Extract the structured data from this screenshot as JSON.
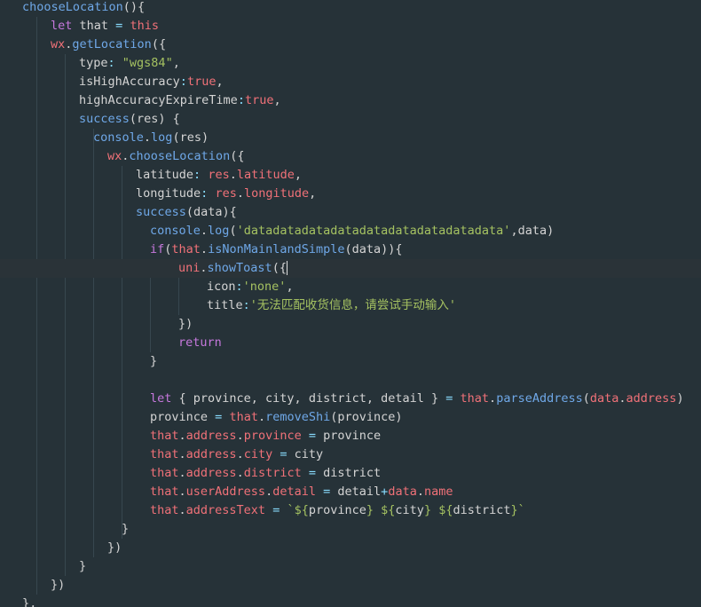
{
  "editor": {
    "colors": {
      "background": "#263238",
      "current_line": "#2a3338",
      "plain": "#d4d4d4",
      "function": "#6fa8e8",
      "keyword": "#c678dd",
      "variable": "#f07178",
      "string": "#a5c261",
      "operator": "#89ddff"
    },
    "lines": [
      [
        [
          "fn",
          "chooseLocation"
        ],
        [
          "punc",
          "(){"
        ]
      ],
      [
        [
          "kw",
          "let"
        ],
        [
          "plain",
          " that "
        ],
        [
          "op",
          "="
        ],
        [
          "plain",
          " "
        ],
        [
          "var",
          "this"
        ]
      ],
      [
        [
          "var",
          "wx"
        ],
        [
          "punc",
          "."
        ],
        [
          "fn",
          "getLocation"
        ],
        [
          "punc",
          "({"
        ]
      ],
      [
        [
          "plain",
          "type"
        ],
        [
          "op",
          ":"
        ],
        [
          "plain",
          " "
        ],
        [
          "str",
          "\"wgs84\""
        ],
        [
          "punc",
          ","
        ]
      ],
      [
        [
          "plain",
          "isHighAccuracy"
        ],
        [
          "op",
          ":"
        ],
        [
          "var",
          "true"
        ],
        [
          "punc",
          ","
        ]
      ],
      [
        [
          "plain",
          "highAccuracyExpireTime"
        ],
        [
          "op",
          ":"
        ],
        [
          "var",
          "true"
        ],
        [
          "punc",
          ","
        ]
      ],
      [
        [
          "fn",
          "success"
        ],
        [
          "punc",
          "(res) {"
        ]
      ],
      [
        [
          "fn",
          "console"
        ],
        [
          "punc",
          "."
        ],
        [
          "fn",
          "log"
        ],
        [
          "punc",
          "(res)"
        ]
      ],
      [
        [
          "var",
          "wx"
        ],
        [
          "punc",
          "."
        ],
        [
          "fn",
          "chooseLocation"
        ],
        [
          "punc",
          "({"
        ]
      ],
      [
        [
          "plain",
          "latitude"
        ],
        [
          "op",
          ":"
        ],
        [
          "plain",
          " "
        ],
        [
          "var",
          "res"
        ],
        [
          "punc",
          "."
        ],
        [
          "var",
          "latitude"
        ],
        [
          "punc",
          ","
        ]
      ],
      [
        [
          "plain",
          "longitude"
        ],
        [
          "op",
          ":"
        ],
        [
          "plain",
          " "
        ],
        [
          "var",
          "res"
        ],
        [
          "punc",
          "."
        ],
        [
          "var",
          "longitude"
        ],
        [
          "punc",
          ","
        ]
      ],
      [
        [
          "fn",
          "success"
        ],
        [
          "punc",
          "(data){"
        ]
      ],
      [
        [
          "fn",
          "console"
        ],
        [
          "punc",
          "."
        ],
        [
          "fn",
          "log"
        ],
        [
          "punc",
          "("
        ],
        [
          "str",
          "'datadatadatadatadatadatadatadatadata'"
        ],
        [
          "punc",
          ",data)"
        ]
      ],
      [
        [
          "kw",
          "if"
        ],
        [
          "punc",
          "("
        ],
        [
          "var",
          "that"
        ],
        [
          "punc",
          "."
        ],
        [
          "fn",
          "isNonMainlandSimple"
        ],
        [
          "punc",
          "(data)){"
        ]
      ],
      [
        [
          "var",
          "uni"
        ],
        [
          "punc",
          "."
        ],
        [
          "fn",
          "showToast"
        ],
        [
          "punc",
          "({"
        ],
        [
          "caret",
          ""
        ]
      ],
      [
        [
          "plain",
          "icon"
        ],
        [
          "op",
          ":"
        ],
        [
          "str",
          "'none'"
        ],
        [
          "punc",
          ","
        ]
      ],
      [
        [
          "plain",
          "title"
        ],
        [
          "op",
          ":"
        ],
        [
          "str",
          "'无法匹配收货信息，请尝试手动输入'"
        ]
      ],
      [
        [
          "punc",
          "})"
        ]
      ],
      [
        [
          "kw",
          "return"
        ]
      ],
      [
        [
          "punc",
          "}"
        ]
      ],
      [],
      [
        [
          "kw",
          "let"
        ],
        [
          "punc",
          " { province, city, district, detail } "
        ],
        [
          "op",
          "="
        ],
        [
          "plain",
          " "
        ],
        [
          "var",
          "that"
        ],
        [
          "punc",
          "."
        ],
        [
          "fn",
          "parseAddress"
        ],
        [
          "punc",
          "("
        ],
        [
          "var",
          "data"
        ],
        [
          "punc",
          "."
        ],
        [
          "var",
          "address"
        ],
        [
          "punc",
          ")"
        ]
      ],
      [
        [
          "plain",
          "province "
        ],
        [
          "op",
          "="
        ],
        [
          "plain",
          " "
        ],
        [
          "var",
          "that"
        ],
        [
          "punc",
          "."
        ],
        [
          "fn",
          "removeShi"
        ],
        [
          "punc",
          "(province)"
        ]
      ],
      [
        [
          "var",
          "that"
        ],
        [
          "punc",
          "."
        ],
        [
          "var",
          "address"
        ],
        [
          "punc",
          "."
        ],
        [
          "var",
          "province"
        ],
        [
          "plain",
          " "
        ],
        [
          "op",
          "="
        ],
        [
          "plain",
          " province"
        ]
      ],
      [
        [
          "var",
          "that"
        ],
        [
          "punc",
          "."
        ],
        [
          "var",
          "address"
        ],
        [
          "punc",
          "."
        ],
        [
          "var",
          "city"
        ],
        [
          "plain",
          " "
        ],
        [
          "op",
          "="
        ],
        [
          "plain",
          " city"
        ]
      ],
      [
        [
          "var",
          "that"
        ],
        [
          "punc",
          "."
        ],
        [
          "var",
          "address"
        ],
        [
          "punc",
          "."
        ],
        [
          "var",
          "district"
        ],
        [
          "plain",
          " "
        ],
        [
          "op",
          "="
        ],
        [
          "plain",
          " district"
        ]
      ],
      [
        [
          "var",
          "that"
        ],
        [
          "punc",
          "."
        ],
        [
          "var",
          "userAddress"
        ],
        [
          "punc",
          "."
        ],
        [
          "var",
          "detail"
        ],
        [
          "plain",
          " "
        ],
        [
          "op",
          "="
        ],
        [
          "plain",
          " detail"
        ],
        [
          "op",
          "+"
        ],
        [
          "var",
          "data"
        ],
        [
          "punc",
          "."
        ],
        [
          "var",
          "name"
        ]
      ],
      [
        [
          "var",
          "that"
        ],
        [
          "punc",
          "."
        ],
        [
          "var",
          "addressText"
        ],
        [
          "plain",
          " "
        ],
        [
          "op",
          "="
        ],
        [
          "plain",
          " "
        ],
        [
          "str",
          "`${"
        ],
        [
          "plain",
          "province"
        ],
        [
          "str",
          "} ${"
        ],
        [
          "plain",
          "city"
        ],
        [
          "str",
          "} ${"
        ],
        [
          "plain",
          "district"
        ],
        [
          "str",
          "}`"
        ]
      ],
      [
        [
          "punc",
          "}"
        ]
      ],
      [
        [
          "punc",
          "})"
        ]
      ],
      [
        [
          "punc",
          "}"
        ]
      ],
      [
        [
          "punc",
          "})"
        ]
      ],
      [
        [
          "punc",
          "},"
        ]
      ]
    ]
  }
}
